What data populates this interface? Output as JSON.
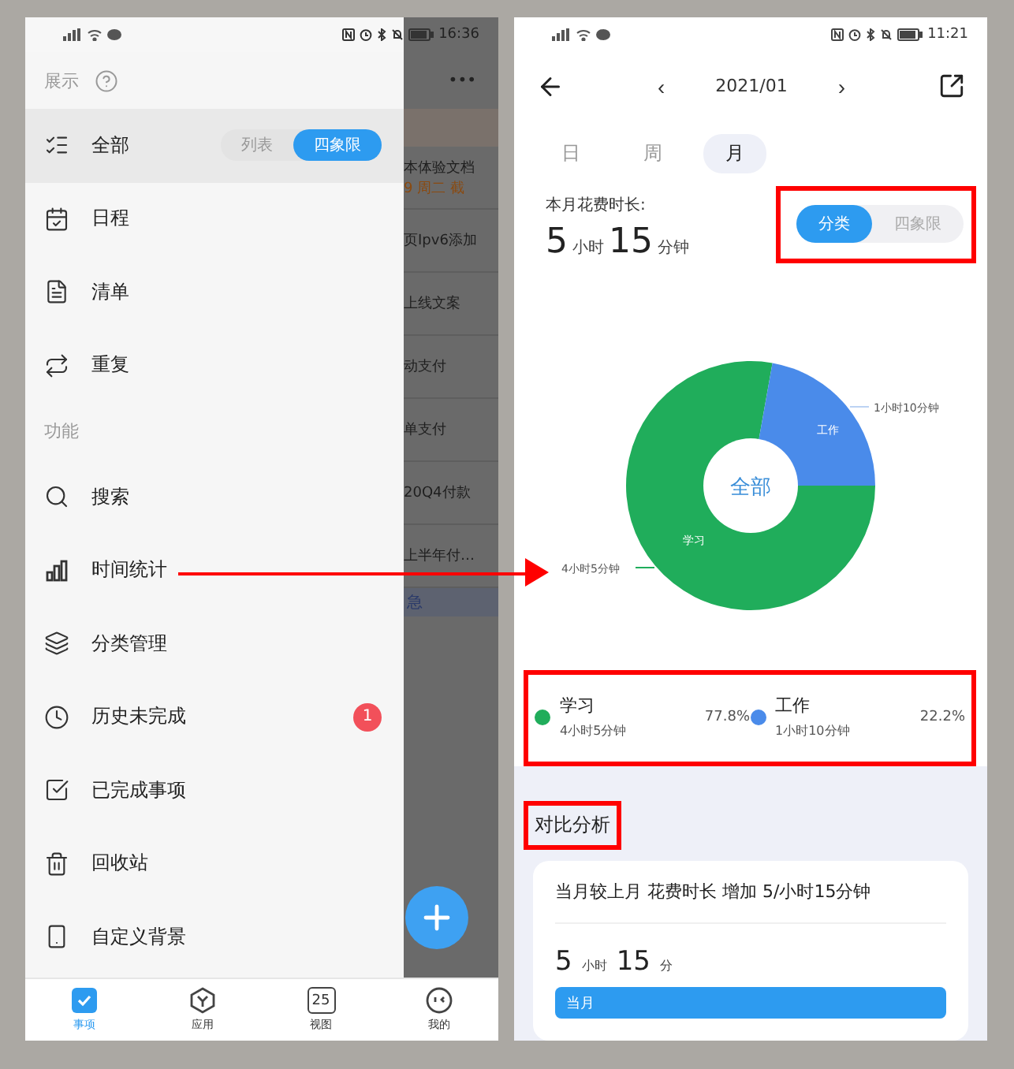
{
  "left_phone": {
    "status_bar": {
      "time": "16:36"
    },
    "background_list": {
      "menu": "•••",
      "rows": [
        {
          "title": "本体验文档",
          "note": "9 周二 截"
        },
        {
          "title": "页Ipv6添加"
        },
        {
          "title": "上线文案"
        },
        {
          "title": "动支付"
        },
        {
          "title": "单支付"
        },
        {
          "title": "20Q4付款"
        },
        {
          "title": "上半年付…"
        }
      ],
      "group_header": "急"
    },
    "drawer": {
      "groups": [
        {
          "label": "展示",
          "items": [
            {
              "label": "全部",
              "selected": true,
              "toggle": [
                {
                  "label": "列表",
                  "selected": false
                },
                {
                  "label": "四象限",
                  "selected": true
                }
              ]
            },
            {
              "label": "日程",
              "selected": false
            },
            {
              "label": "清单",
              "selected": false
            },
            {
              "label": "重复",
              "selected": false
            }
          ]
        },
        {
          "label": "功能",
          "items": [
            {
              "label": "搜索",
              "selected": false
            },
            {
              "label": "时间统计",
              "selected": false
            },
            {
              "label": "分类管理",
              "selected": false
            },
            {
              "label": "历史未完成",
              "selected": false,
              "badge": "1"
            },
            {
              "label": "已完成事项",
              "selected": false
            },
            {
              "label": "回收站",
              "selected": false
            },
            {
              "label": "自定义背景",
              "selected": false
            }
          ]
        }
      ]
    },
    "tab_bar": [
      {
        "label": "事项",
        "selected": true
      },
      {
        "label": "应用",
        "selected": false
      },
      {
        "label": "视图",
        "selected": false,
        "icon_text": "25"
      },
      {
        "label": "我的",
        "selected": false
      }
    ]
  },
  "right_phone": {
    "status_bar": {
      "time": "11:21"
    },
    "header": {
      "prev": "‹",
      "period": "2021/01",
      "next": "›"
    },
    "period_tabs": [
      {
        "label": "日",
        "selected": false
      },
      {
        "label": "周",
        "selected": false
      },
      {
        "label": "月",
        "selected": true
      }
    ],
    "summary": {
      "label": "本月花费时长:",
      "hours": "5",
      "hours_unit": "小时",
      "minutes": "15",
      "minutes_unit": "分钟"
    },
    "view_toggle": [
      {
        "label": "分类",
        "selected": true
      },
      {
        "label": "四象限",
        "selected": false
      }
    ],
    "chart": {
      "center_label": "全部",
      "slice_value_labels": [
        "4小时5分钟",
        "1小时10分钟"
      ],
      "chart_data": {
        "type": "donut",
        "categories": [
          "学习",
          "工作"
        ],
        "values": [
          77.8,
          22.2
        ]
      }
    },
    "legend": [
      {
        "name": "学习",
        "duration": "4小时5分钟",
        "percent": "77.8%",
        "color": "#20ad5b"
      },
      {
        "name": "工作",
        "duration": "1小时10分钟",
        "percent": "22.2%",
        "color": "#4a8bea"
      }
    ],
    "comparison": {
      "title": "对比分析",
      "summary": "当月较上月 花费时长 增加 5/小时15分钟",
      "hours": "5",
      "hours_unit": "小时",
      "minutes": "15",
      "minutes_unit": "分",
      "bar": {
        "label": "当月",
        "level": 1
      }
    }
  }
}
